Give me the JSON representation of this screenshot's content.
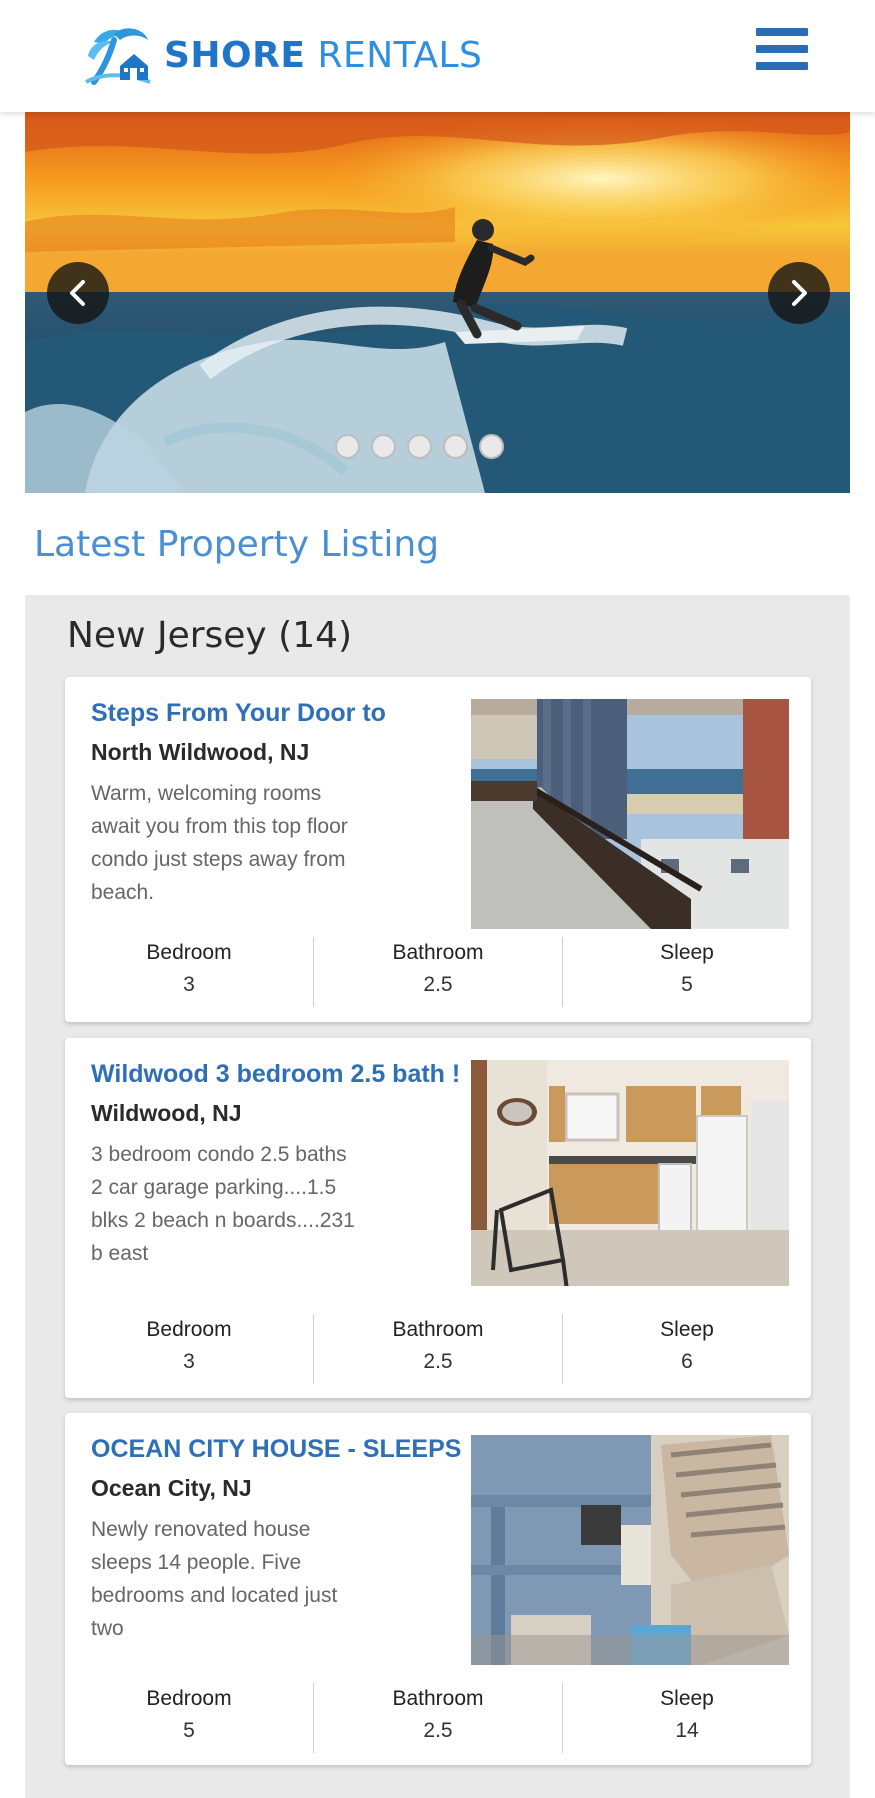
{
  "header": {
    "brand_primary": "SHORE",
    "brand_secondary": "RENTALS",
    "logo_icon": "palm-house-logo",
    "menu_icon": "hamburger-icon",
    "colors": {
      "brand": "#1f75c7",
      "menu": "#2b6db5"
    }
  },
  "hero": {
    "prev_icon": "chevron-left-icon",
    "next_icon": "chevron-right-icon",
    "slide_count": 5
  },
  "section_title": "Latest Property Listing",
  "group": {
    "title": "New Jersey (14)",
    "listings": [
      {
        "title": "Steps From Your Door to",
        "location": "North Wildwood, NJ",
        "description": "Warm, welcoming rooms await you from this top floor condo just steps away from beach.",
        "bedroom_label": "Bedroom",
        "bedroom": "3",
        "bathroom_label": "Bathroom",
        "bathroom": "2.5",
        "sleep_label": "Sleep",
        "sleep": "5"
      },
      {
        "title": "Wildwood 3 bedroom 2.5 bath !",
        "location": "Wildwood, NJ",
        "description": "3 bedroom condo 2.5 baths 2 car garage parking....1.5 blks 2 beach n boards....231 b east",
        "bedroom_label": "Bedroom",
        "bedroom": "3",
        "bathroom_label": "Bathroom",
        "bathroom": "2.5",
        "sleep_label": "Sleep",
        "sleep": "6"
      },
      {
        "title": "OCEAN CITY HOUSE - SLEEPS",
        "location": "Ocean City, NJ",
        "description": "Newly renovated house sleeps 14 people. Five bedrooms and located just two",
        "bedroom_label": "Bedroom",
        "bedroom": "5",
        "bathroom_label": "Bathroom",
        "bathroom": "2.5",
        "sleep_label": "Sleep",
        "sleep": "14"
      }
    ]
  }
}
